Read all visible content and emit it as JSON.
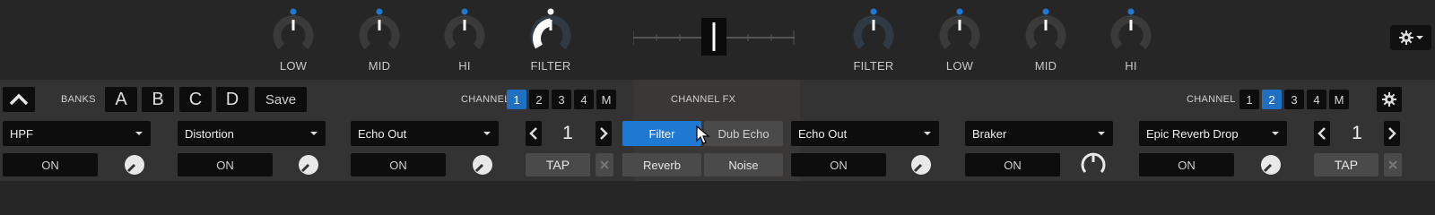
{
  "mixer": {
    "deck_left": {
      "knobs": [
        {
          "label": "LOW",
          "icon": "eq-knob"
        },
        {
          "label": "MID",
          "icon": "eq-knob"
        },
        {
          "label": "HI",
          "icon": "eq-knob"
        },
        {
          "label": "FILTER",
          "icon": "filter-knob"
        }
      ]
    },
    "deck_right": {
      "knobs": [
        {
          "label": "FILTER",
          "icon": "filter-knob"
        },
        {
          "label": "LOW",
          "icon": "eq-knob"
        },
        {
          "label": "MID",
          "icon": "eq-knob"
        },
        {
          "label": "HI",
          "icon": "eq-knob"
        }
      ]
    },
    "settings_icon": "gear-icon",
    "crossfader_position": 0.5
  },
  "fx": {
    "left": {
      "banks_label": "BANKS",
      "banks": [
        "A",
        "B",
        "C",
        "D"
      ],
      "save_label": "Save",
      "channel_label": "CHANNEL",
      "channels": [
        "1",
        "2",
        "3",
        "4",
        "M"
      ],
      "active_channel": "1",
      "effects": [
        {
          "name": "HPF",
          "on_label": "ON"
        },
        {
          "name": "Distortion",
          "on_label": "ON"
        },
        {
          "name": "Echo Out",
          "on_label": "ON"
        }
      ],
      "beats": "1",
      "tap_label": "TAP"
    },
    "center": {
      "title": "CHANNEL FX",
      "buttons": [
        {
          "label": "Filter",
          "active": true
        },
        {
          "label": "Dub Echo",
          "active": false
        },
        {
          "label": "Reverb",
          "active": false
        },
        {
          "label": "Noise",
          "active": false
        }
      ]
    },
    "right": {
      "channel_label": "CHANNEL",
      "channels": [
        "1",
        "2",
        "3",
        "4",
        "M"
      ],
      "active_channel": "2",
      "effects": [
        {
          "name": "Echo Out",
          "on_label": "ON"
        },
        {
          "name": "Braker",
          "on_label": "ON"
        },
        {
          "name": "Epic Reverb Drop",
          "on_label": "ON"
        }
      ],
      "beats": "1",
      "tap_label": "TAP"
    }
  },
  "colors": {
    "accent": "#1f6fc2",
    "background": "#262626",
    "panel": "#333333",
    "button": "#0d0d0d"
  }
}
